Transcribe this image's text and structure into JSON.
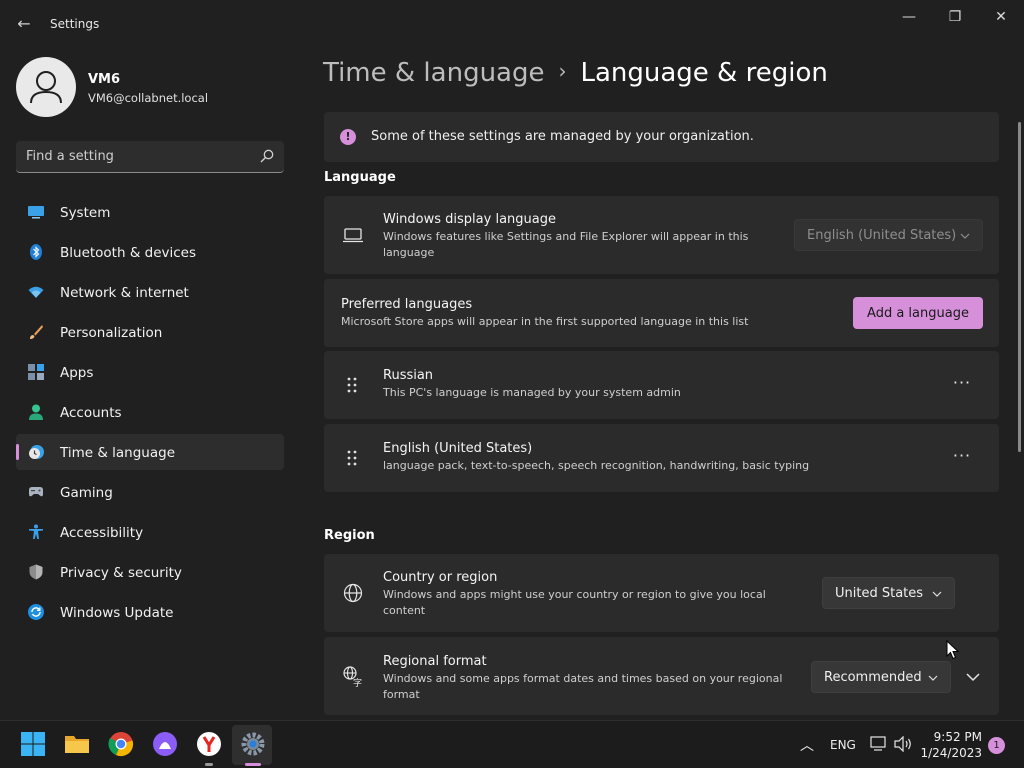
{
  "window": {
    "title": "Settings",
    "back_glyph": "←",
    "minimize_glyph": "—",
    "maximize_glyph": "❐",
    "close_glyph": "✕"
  },
  "profile": {
    "name": "VM6",
    "email": "VM6@collabnet.local"
  },
  "search": {
    "placeholder": "Find a setting"
  },
  "sidebar": {
    "items": [
      {
        "label": "System",
        "icon": "monitor-icon"
      },
      {
        "label": "Bluetooth & devices",
        "icon": "bluetooth-icon"
      },
      {
        "label": "Network & internet",
        "icon": "wifi-icon"
      },
      {
        "label": "Personalization",
        "icon": "brush-icon"
      },
      {
        "label": "Apps",
        "icon": "apps-icon"
      },
      {
        "label": "Accounts",
        "icon": "person-icon"
      },
      {
        "label": "Time & language",
        "icon": "clock-globe-icon",
        "selected": true
      },
      {
        "label": "Gaming",
        "icon": "gamepad-icon"
      },
      {
        "label": "Accessibility",
        "icon": "accessibility-icon"
      },
      {
        "label": "Privacy & security",
        "icon": "shield-icon"
      },
      {
        "label": "Windows Update",
        "icon": "update-icon"
      }
    ]
  },
  "breadcrumb": {
    "parent": "Time & language",
    "separator": "›",
    "current": "Language & region"
  },
  "info_bar": {
    "icon_glyph": "!",
    "text": "Some of these settings are managed by your organization."
  },
  "language_section": {
    "title": "Language",
    "display_language": {
      "title": "Windows display language",
      "description": "Windows features like Settings and File Explorer will appear in this language",
      "value": "English (United States)",
      "disabled": true
    },
    "preferred": {
      "title": "Preferred languages",
      "description": "Microsoft Store apps will appear in the first supported language in this list",
      "add_button": "Add a language"
    },
    "languages": [
      {
        "name": "Russian",
        "description": "This PC's language is managed by your system admin",
        "more": "···"
      },
      {
        "name": "English (United States)",
        "description": "language pack, text-to-speech, speech recognition, handwriting, basic typing",
        "more": "···"
      }
    ]
  },
  "region_section": {
    "title": "Region",
    "country": {
      "title": "Country or region",
      "description": "Windows and apps might use your country or region to give you local content",
      "value": "United States"
    },
    "format": {
      "title": "Regional format",
      "description": "Windows and some apps format dates and times based on your regional format",
      "value": "Recommended"
    }
  },
  "taskbar": {
    "apps": [
      "start-icon",
      "file-explorer-icon",
      "chrome-icon",
      "alice-icon",
      "yandex-browser-icon",
      "settings-icon"
    ],
    "tray_chevron": "︿",
    "input_language": "ENG",
    "time": "9:52 PM",
    "date": "1/24/2023",
    "notifications": "1"
  },
  "colors": {
    "accent": "#d68fd9",
    "background": "#202020",
    "card": "#2b2b2b"
  }
}
